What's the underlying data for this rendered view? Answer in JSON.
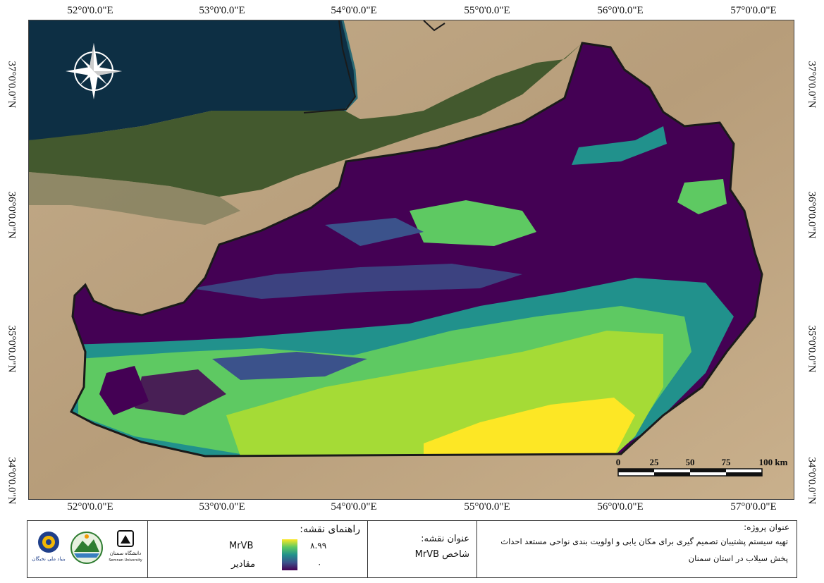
{
  "map": {
    "lon_labels": [
      "52°0'0.0\"E",
      "53°0'0.0\"E",
      "54°0'0.0\"E",
      "55°0'0.0\"E",
      "56°0'0.0\"E",
      "57°0'0.0\"E"
    ],
    "lat_labels": [
      "37°0'0.0\"N",
      "36°0'0.0\"N",
      "35°0'0.0\"N",
      "34°0'0.0\"N"
    ],
    "colors": {
      "sea": "#0d2f44",
      "land": "#b9a281",
      "forest": "#41582c",
      "low": "#440154",
      "mid_low": "#3b528b",
      "mid": "#21918c",
      "mid_high": "#5ec962",
      "high": "#fde725",
      "boundary": "#1a1a1a"
    },
    "compass_icon": "north-arrow-compass-icon",
    "scalebar": {
      "labels": [
        "0",
        "25",
        "50",
        "75",
        "100 km"
      ]
    }
  },
  "legend": {
    "title": "راهنمای نقشه:",
    "layer_name": "MrVB",
    "max_value": "۸.۹۹",
    "min_value": "۰",
    "values_label": "مقادیر"
  },
  "map_title": {
    "label": "عنوان نقشه:",
    "value": "شاخص MrVB"
  },
  "project": {
    "label": "عنوان پروژه:",
    "line1": "تهیه سیستم پشتیبان تصمیم گیری برای مکان یابی و اولویت بندی نواحی مستعد احداث",
    "line2": "پخش سیلاب در استان سمنان"
  },
  "logos": {
    "semnan_univ": "دانشگاه سمنان",
    "semnan_univ_en": "Semnan University",
    "elites": "بنیاد ملی نخبگان"
  }
}
